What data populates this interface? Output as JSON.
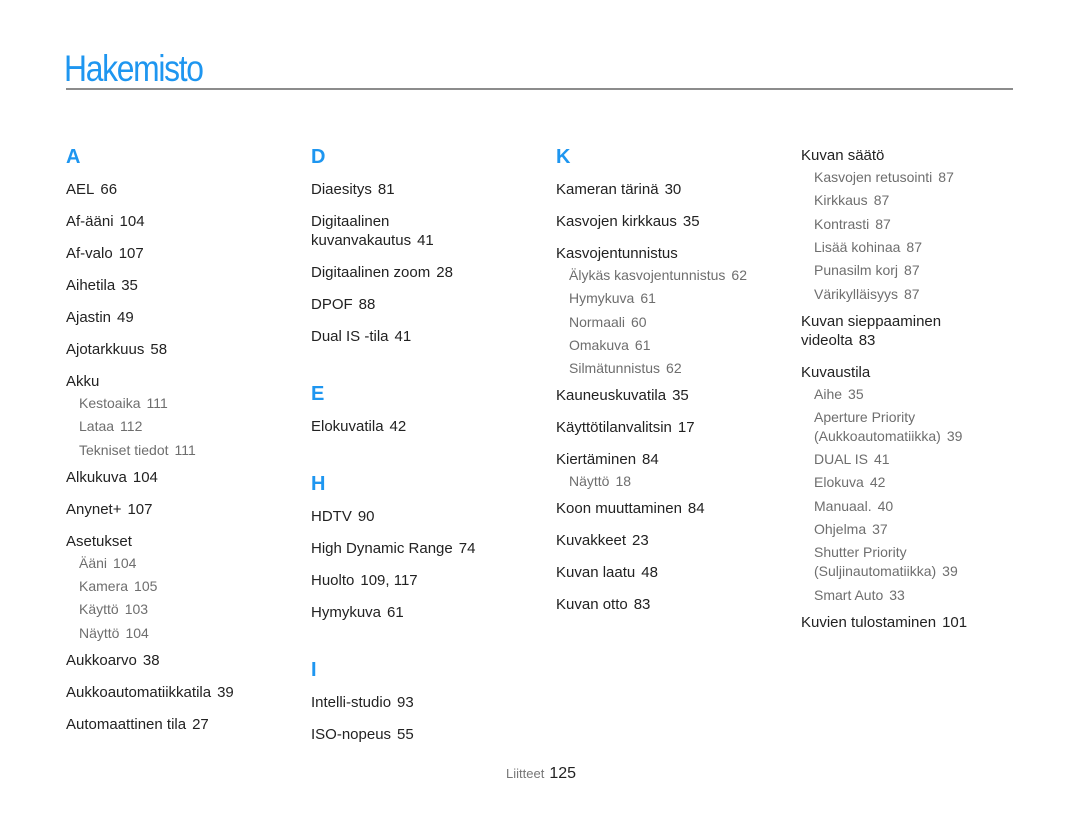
{
  "title": "Hakemisto",
  "accent_color": "#1e96f0",
  "footer": {
    "section": "Liitteet",
    "page": "125"
  },
  "columns": [
    {
      "groups": [
        {
          "letter": "A",
          "entries": [
            {
              "term": "AEL",
              "page": "66"
            },
            {
              "term": "Af-ääni",
              "page": "104"
            },
            {
              "term": "Af-valo",
              "page": "107"
            },
            {
              "term": "Aihetila",
              "page": "35"
            },
            {
              "term": "Ajastin",
              "page": "49"
            },
            {
              "term": "Ajotarkkuus",
              "page": "58"
            },
            {
              "term": "Akku",
              "page": "",
              "subs": [
                {
                  "term": "Kestoaika",
                  "page": "111"
                },
                {
                  "term": "Lataa",
                  "page": "112"
                },
                {
                  "term": "Tekniset tiedot",
                  "page": "111"
                }
              ]
            },
            {
              "term": "Alkukuva",
              "page": "104"
            },
            {
              "term": "Anynet+",
              "page": "107"
            },
            {
              "term": "Asetukset",
              "page": "",
              "subs": [
                {
                  "term": "Ääni",
                  "page": "104"
                },
                {
                  "term": "Kamera",
                  "page": "105"
                },
                {
                  "term": "Käyttö",
                  "page": "103"
                },
                {
                  "term": "Näyttö",
                  "page": "104"
                }
              ]
            },
            {
              "term": "Aukkoarvo",
              "page": "38"
            },
            {
              "term": "Aukkoautomatiikkatila",
              "page": "39"
            },
            {
              "term": "Automaattinen tila",
              "page": "27"
            }
          ]
        }
      ]
    },
    {
      "groups": [
        {
          "letter": "D",
          "entries": [
            {
              "term": "Diaesitys",
              "page": "81"
            },
            {
              "term": "Digitaalinen",
              "term2": "kuvanvakautus",
              "page": "41"
            },
            {
              "term": "Digitaalinen zoom",
              "page": "28"
            },
            {
              "term": "DPOF",
              "page": "88"
            },
            {
              "term": "Dual IS -tila",
              "page": "41"
            }
          ]
        },
        {
          "letter": "E",
          "entries": [
            {
              "term": "Elokuvatila",
              "page": "42"
            }
          ]
        },
        {
          "letter": "H",
          "entries": [
            {
              "term": "HDTV",
              "page": "90"
            },
            {
              "term": "High Dynamic Range",
              "page": "74"
            },
            {
              "term": "Huolto",
              "page": "109, 117"
            },
            {
              "term": "Hymykuva",
              "page": "61"
            }
          ]
        },
        {
          "letter": "I",
          "entries": [
            {
              "term": "Intelli-studio",
              "page": "93"
            },
            {
              "term": "ISO-nopeus",
              "page": "55"
            }
          ]
        }
      ]
    },
    {
      "groups": [
        {
          "letter": "K",
          "entries": [
            {
              "term": "Kameran tärinä",
              "page": "30"
            },
            {
              "term": "Kasvojen kirkkaus",
              "page": "35"
            },
            {
              "term": "Kasvojentunnistus",
              "page": "",
              "subs": [
                {
                  "term": "Älykäs kasvojentunnistus",
                  "page": "62"
                },
                {
                  "term": "Hymykuva",
                  "page": "61"
                },
                {
                  "term": "Normaali",
                  "page": "60"
                },
                {
                  "term": "Omakuva",
                  "page": "61"
                },
                {
                  "term": "Silmätunnistus",
                  "page": "62"
                }
              ]
            },
            {
              "term": "Kauneuskuvatila",
              "page": "35"
            },
            {
              "term": "Käyttötilanvalitsin",
              "page": "17"
            },
            {
              "term": "Kiertäminen",
              "page": "84",
              "subs": [
                {
                  "term": "Näyttö",
                  "page": "18"
                }
              ]
            },
            {
              "term": "Koon muuttaminen",
              "page": "84"
            },
            {
              "term": "Kuvakkeet",
              "page": "23"
            },
            {
              "term": "Kuvan laatu",
              "page": "48"
            },
            {
              "term": "Kuvan otto",
              "page": "83"
            }
          ]
        }
      ]
    },
    {
      "groups": [
        {
          "letter": "",
          "entries": [
            {
              "term": "Kuvan säätö",
              "page": "",
              "subs": [
                {
                  "term": "Kasvojen retusointi",
                  "page": "87"
                },
                {
                  "term": "Kirkkaus",
                  "page": "87"
                },
                {
                  "term": "Kontrasti",
                  "page": "87"
                },
                {
                  "term": "Lisää kohinaa",
                  "page": "87"
                },
                {
                  "term": "Punasilm korj",
                  "page": "87"
                },
                {
                  "term": "Värikylläisyys",
                  "page": "87"
                }
              ]
            },
            {
              "term": "Kuvan sieppaaminen",
              "term2": "videolta",
              "page": "83"
            },
            {
              "term": "Kuvaustila",
              "page": "",
              "subs": [
                {
                  "term": "Aihe",
                  "page": "35"
                },
                {
                  "term": "Aperture Priority",
                  "term2": "(Aukkoautomatiikka)",
                  "page": "39"
                },
                {
                  "term": "DUAL IS",
                  "page": "41"
                },
                {
                  "term": "Elokuva",
                  "page": "42"
                },
                {
                  "term": "Manuaal.",
                  "page": "40"
                },
                {
                  "term": "Ohjelma",
                  "page": "37"
                },
                {
                  "term": "Shutter Priority",
                  "term2": "(Suljinautomatiikka)",
                  "page": "39"
                },
                {
                  "term": "Smart Auto",
                  "page": "33"
                }
              ]
            },
            {
              "term": "Kuvien tulostaminen",
              "page": "101"
            }
          ]
        }
      ]
    }
  ]
}
